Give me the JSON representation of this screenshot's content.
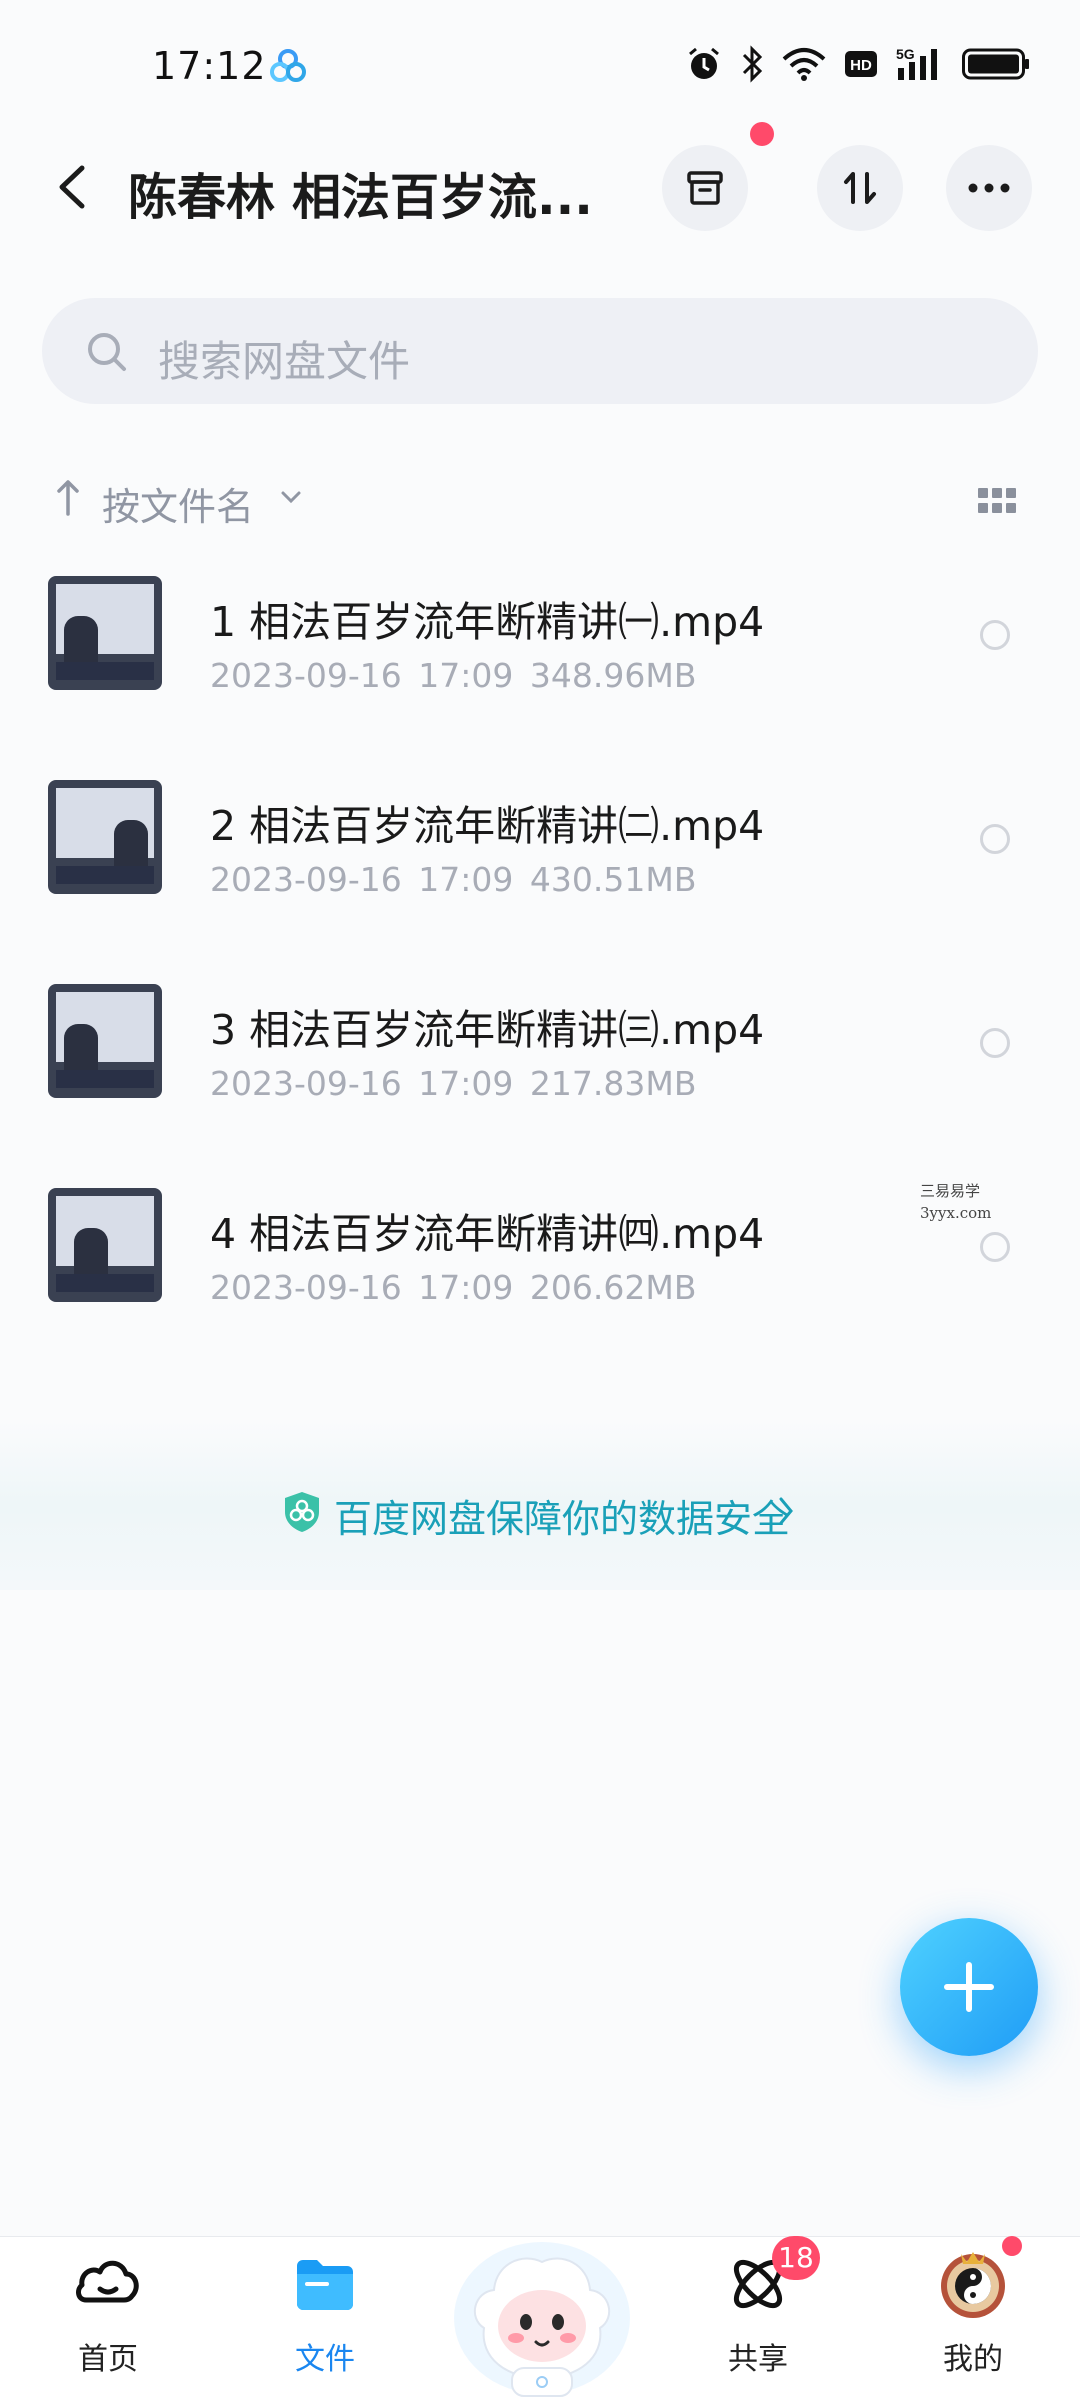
{
  "status_bar": {
    "time": "17:12",
    "icons": [
      "alarm-icon",
      "bluetooth-icon",
      "wifi-icon",
      "hd-icon",
      "5g-signal-icon",
      "battery-icon"
    ],
    "hd_label": "HD",
    "network_label": "5G"
  },
  "header": {
    "title": "陈春林 相法百岁流...",
    "buttons": [
      "archive-icon",
      "sort-toggle-icon",
      "more-icon"
    ]
  },
  "search": {
    "placeholder": "搜索网盘文件"
  },
  "sort": {
    "label": "按文件名"
  },
  "files": [
    {
      "name": "1 相法百岁流年断精讲㈠.mp4",
      "date": "2023-09-16",
      "time": "17:09",
      "size": "348.96MB"
    },
    {
      "name": "2 相法百岁流年断精讲㈡.mp4",
      "date": "2023-09-16",
      "time": "17:09",
      "size": "430.51MB"
    },
    {
      "name": "3 相法百岁流年断精讲㈢.mp4",
      "date": "2023-09-16",
      "time": "17:09",
      "size": "217.83MB"
    },
    {
      "name": "4 相法百岁流年断精讲㈣.mp4",
      "date": "2023-09-16",
      "time": "17:09",
      "size": "206.62MB"
    }
  ],
  "watermark": {
    "line1": "三易易学",
    "line2": "3yyx.com"
  },
  "banner": {
    "text": "百度网盘保障你的数据安全"
  },
  "nav": {
    "home": "首页",
    "files": "文件",
    "share": "共享",
    "share_badge": "18",
    "mine": "我的"
  },
  "colors": {
    "accent": "#1a86f0",
    "badge": "#ff4a6a",
    "banner_text": "#1aa0b8"
  }
}
